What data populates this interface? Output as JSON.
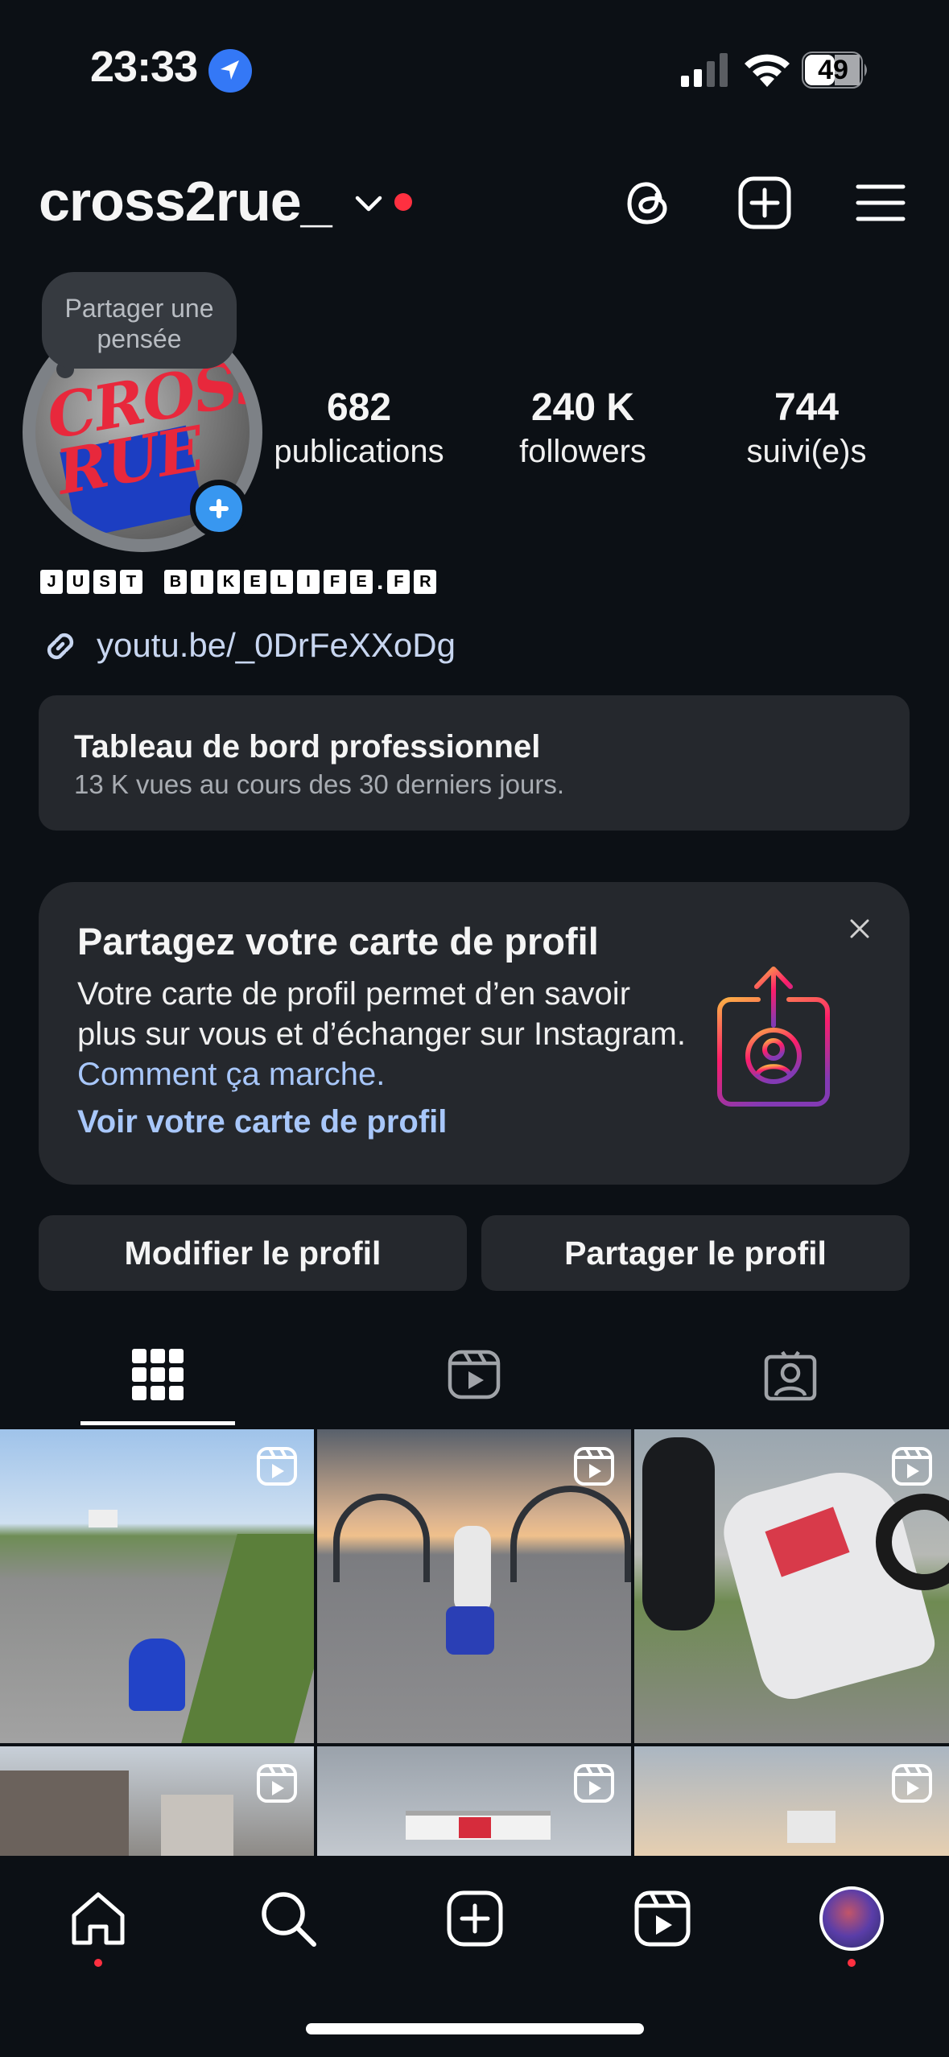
{
  "status_bar": {
    "time": "23:33",
    "battery": "49"
  },
  "header": {
    "username": "cross2rue_"
  },
  "avatar": {
    "thought_bubble": "Partager une pensée",
    "avatar_text": "CROSS RUE"
  },
  "stats": [
    {
      "value": "682",
      "label": "publications"
    },
    {
      "value": "240 K",
      "label": "followers"
    },
    {
      "value": "744",
      "label": "suivi(e)s"
    }
  ],
  "bio": {
    "words": [
      [
        "J",
        "U",
        "S",
        "T"
      ],
      [
        "B",
        "I",
        "K",
        "E",
        "L",
        "I",
        "F",
        "E"
      ],
      [
        "F",
        "R"
      ]
    ],
    "dot": "."
  },
  "link": {
    "text": "youtu.be/_0DrFeXXoDg"
  },
  "dashboard": {
    "title": "Tableau de bord professionnel",
    "subtitle": "13 K vues au cours des 30 derniers jours."
  },
  "profile_card": {
    "title": "Partagez votre carte de profil",
    "body": "Votre carte de profil permet d’en savoir plus sur vous et d’échanger sur Instagram.",
    "body_link": "Comment ça marche.",
    "cta": "Voir votre carte de profil"
  },
  "buttons": {
    "edit": "Modifier le profil",
    "share": "Partager le profil"
  },
  "colors": {
    "background": "#0c1015",
    "card": "#25282d",
    "accent_blue": "#3897f0",
    "link_blue": "#a8c7fa",
    "notification_red": "#ff3040"
  }
}
